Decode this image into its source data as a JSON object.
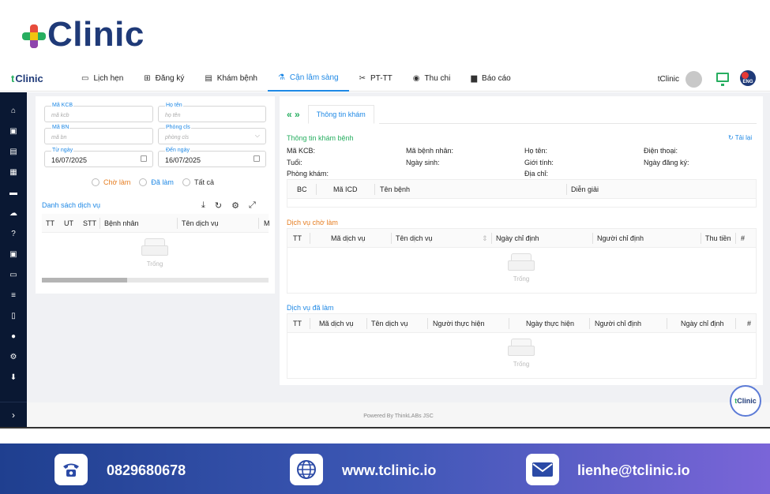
{
  "brand": {
    "name": "Clinic",
    "nav_logo": "Clinic"
  },
  "nav": {
    "items": [
      {
        "icon": "calendar-icon",
        "glyph": "▭",
        "label": "Lịch hẹn"
      },
      {
        "icon": "register-icon",
        "glyph": "⊞",
        "label": "Đăng ký"
      },
      {
        "icon": "clipboard-icon",
        "glyph": "▤",
        "label": "Khám bệnh"
      },
      {
        "icon": "flask-icon",
        "glyph": "⚗",
        "label": "Cận lâm sàng"
      },
      {
        "icon": "scissors-icon",
        "glyph": "✂",
        "label": "PT-TT"
      },
      {
        "icon": "money-icon",
        "glyph": "◉",
        "label": "Thu chi"
      },
      {
        "icon": "chart-icon",
        "glyph": "▆",
        "label": "Báo cáo"
      }
    ],
    "active_index": 3,
    "user_name": "tClinic",
    "lang": "ENG"
  },
  "sidebar": {
    "icons": [
      "home-icon",
      "id-card-icon",
      "document-icon",
      "storage-icon",
      "card-icon",
      "cloud-upload-icon",
      "help-icon",
      "id-badge-icon",
      "cash-icon",
      "list-icon",
      "file-icon",
      "user-circle-icon",
      "settings-icon",
      "download-icon"
    ],
    "glyphs": [
      "⌂",
      "▣",
      "▤",
      "▦",
      "▬",
      "☁",
      "?",
      "▣",
      "▭",
      "≡",
      "▯",
      "●",
      "⚙",
      "⬇"
    ],
    "expand_glyph": "›"
  },
  "filters": {
    "ma_kcb": {
      "label": "Mã KCB",
      "placeholder": "mã kcb"
    },
    "ho_ten": {
      "label": "Họ tên",
      "placeholder": "họ tên"
    },
    "ma_bn": {
      "label": "Mã BN",
      "placeholder": "mã bn"
    },
    "phong_cls": {
      "label": "Phòng cls",
      "placeholder": "phòng cls"
    },
    "tu_ngay": {
      "label": "Từ ngày",
      "value": "16/07/2025"
    },
    "den_ngay": {
      "label": "Đến ngày",
      "value": "16/07/2025"
    },
    "radios": [
      "Chờ làm",
      "Đã làm",
      "Tất cả"
    ]
  },
  "service_list": {
    "title": "Danh sách dịch vụ",
    "columns": [
      "TT",
      "UT",
      "STT",
      "Bệnh nhân",
      "Tên dịch vụ",
      "M"
    ],
    "empty": "Trống"
  },
  "detail": {
    "tab_label": "Thông tin khám",
    "section_title": "Thông tin khám bệnh",
    "reload": "Tải lại",
    "fields": {
      "ma_kcb": "Mã KCB:",
      "ma_benh_nhan": "Mã bệnh nhân:",
      "ho_ten": "Họ tên:",
      "dien_thoai": "Điện thoại:",
      "tuoi": "Tuổi:",
      "ngay_sinh": "Ngày sinh:",
      "gioi_tinh": "Giới tính:",
      "ngay_dang_ky": "Ngày đăng ký:",
      "phong_kham": "Phòng khám:",
      "dia_chi": "Địa chỉ:"
    },
    "diag_columns": [
      "BC",
      "Mã ICD",
      "Tên bệnh",
      "Diễn giải"
    ],
    "pending": {
      "title": "Dịch vụ chờ làm",
      "columns": [
        "TT",
        "Mã dịch vụ",
        "Tên dịch vụ",
        "Ngày chỉ định",
        "Người chỉ định",
        "Thu tiền",
        "#"
      ],
      "empty": "Trống"
    },
    "done": {
      "title": "Dịch vụ đã làm",
      "columns": [
        "TT",
        "Mã dịch vụ",
        "Tên dịch vụ",
        "Người thực hiện",
        "Ngày thực hiện",
        "Người chỉ định",
        "Ngày chỉ định",
        "#"
      ],
      "empty": "Trống"
    }
  },
  "footer": {
    "powered": "Powered By ThinkLABs JSC"
  },
  "chat_widget": "Clinic",
  "contact": {
    "phone": "0829680678",
    "website": "www.tclinic.io",
    "email": "lienhe@tclinic.io"
  },
  "colors": {
    "navy": "#0a1833",
    "brand_blue": "#1f3a78",
    "accent_blue": "#1e88e5",
    "pending_orange": "#e67e22",
    "green": "#27ae60"
  }
}
